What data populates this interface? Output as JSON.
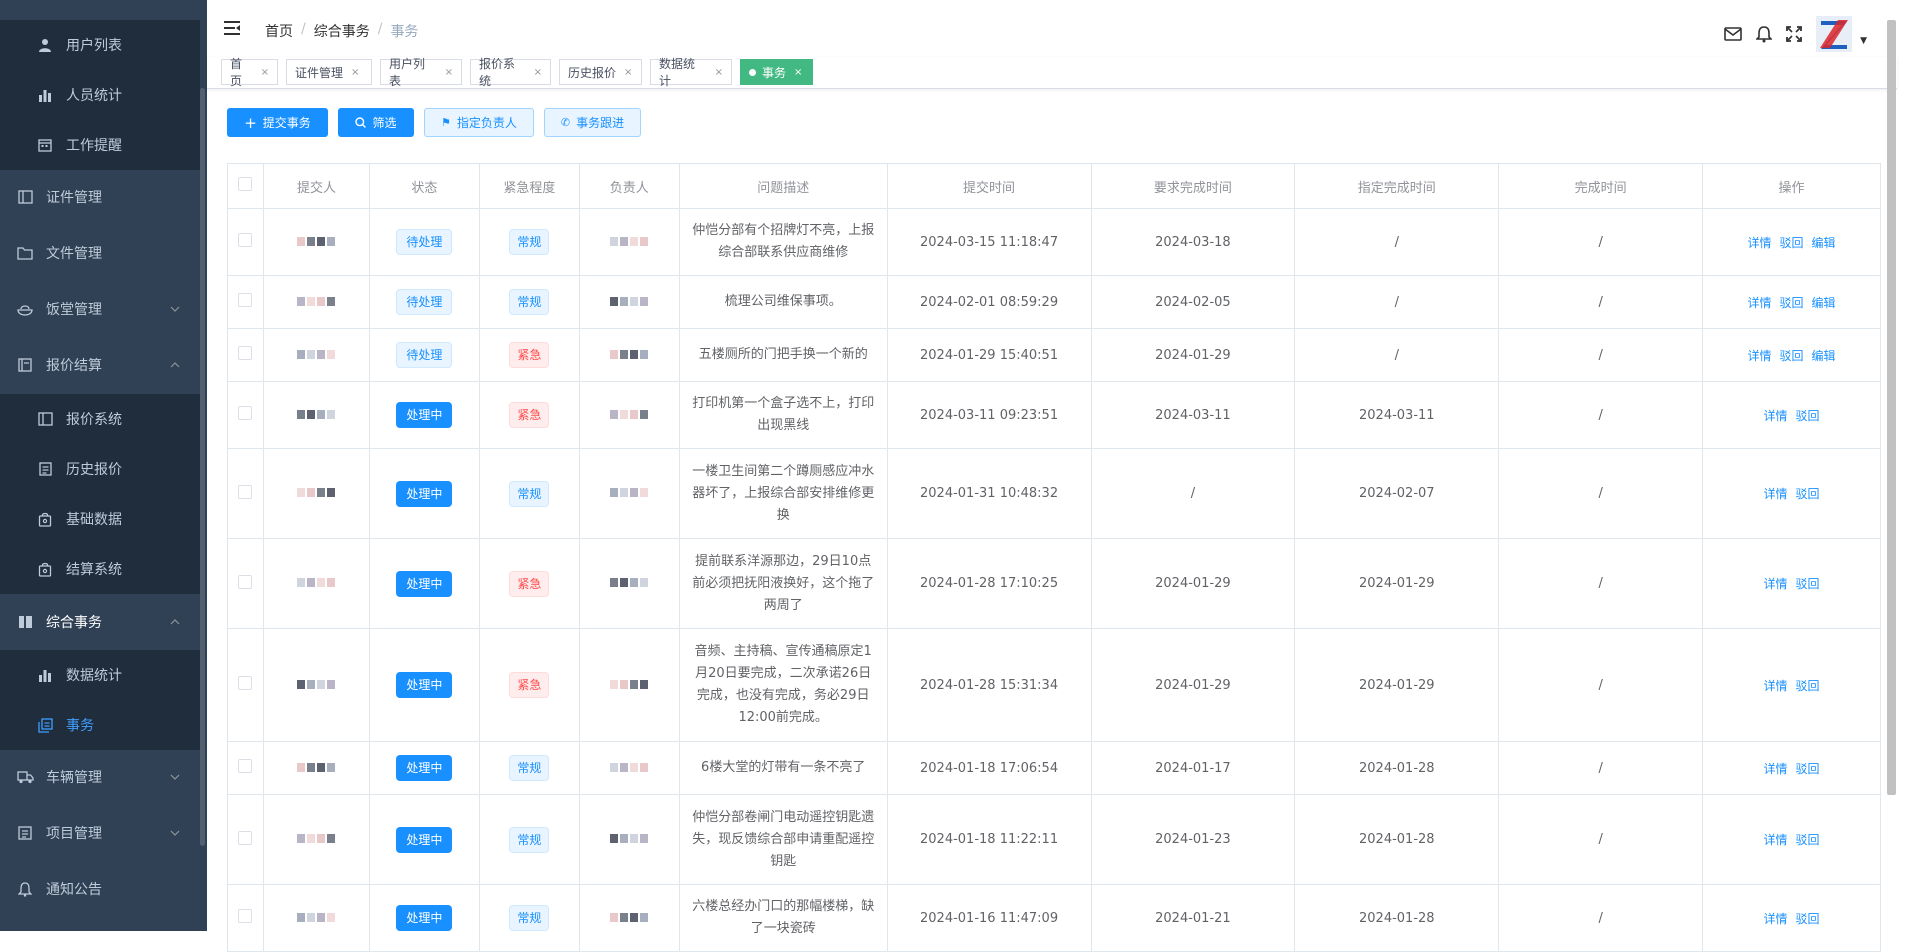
{
  "sidebar": {
    "items": [
      {
        "label": "用户列表",
        "icon": "user-icon",
        "sub": true
      },
      {
        "label": "人员统计",
        "icon": "bar-chart-icon",
        "sub": true
      },
      {
        "label": "工作提醒",
        "icon": "calendar-icon",
        "sub": true
      },
      {
        "label": "证件管理",
        "icon": "book-icon",
        "sub": false
      },
      {
        "label": "文件管理",
        "icon": "folder-icon",
        "sub": false
      },
      {
        "label": "饭堂管理",
        "icon": "bowl-icon",
        "sub": false,
        "arrow": "down"
      },
      {
        "label": "报价结算",
        "icon": "ledger-icon",
        "sub": false,
        "arrow": "up"
      },
      {
        "label": "报价系统",
        "icon": "book-icon",
        "sub": true
      },
      {
        "label": "历史报价",
        "icon": "document-icon",
        "sub": true
      },
      {
        "label": "基础数据",
        "icon": "bag-icon",
        "sub": true
      },
      {
        "label": "结算系统",
        "icon": "bag-icon",
        "sub": true
      },
      {
        "label": "综合事务",
        "icon": "book-open-icon",
        "sub": false,
        "arrow": "up",
        "bold": true
      },
      {
        "label": "数据统计",
        "icon": "bar-chart-icon",
        "sub": true
      },
      {
        "label": "事务",
        "icon": "copy-icon",
        "sub": true,
        "active": true
      },
      {
        "label": "车辆管理",
        "icon": "truck-icon",
        "sub": false,
        "arrow": "down"
      },
      {
        "label": "项目管理",
        "icon": "list-icon",
        "sub": false,
        "arrow": "down"
      },
      {
        "label": "通知公告",
        "icon": "bell-icon",
        "sub": false
      }
    ]
  },
  "breadcrumb": {
    "home": "首页",
    "parent": "综合事务",
    "current": "事务"
  },
  "tags": [
    "首页",
    "证件管理",
    "用户列表",
    "报价系统",
    "历史报价",
    "数据统计",
    "事务"
  ],
  "toolbar": {
    "submit": "提交事务",
    "filter": "筛选",
    "assign": "指定负责人",
    "track": "事务跟进"
  },
  "table": {
    "headers": [
      "提交人",
      "状态",
      "紧急程度",
      "负责人",
      "问题描述",
      "提交时间",
      "要求完成时间",
      "指定完成时间",
      "完成时间",
      "操作"
    ],
    "rows": [
      {
        "status": "待处理",
        "urgency": "常规",
        "desc": "仲恺分部有个招牌灯不亮，上报综合部联系供应商维修",
        "submitted": "2024-03-15 11:18:47",
        "required": "2024-03-18",
        "assigned": "/",
        "completed": "/",
        "ops": [
          "详情",
          "驳回",
          "编辑"
        ]
      },
      {
        "status": "待处理",
        "urgency": "常规",
        "desc": "梳理公司维保事项。",
        "submitted": "2024-02-01 08:59:29",
        "required": "2024-02-05",
        "assigned": "/",
        "completed": "/",
        "ops": [
          "详情",
          "驳回",
          "编辑"
        ]
      },
      {
        "status": "待处理",
        "urgency": "紧急",
        "desc": "五楼厕所的门把手换一个新的",
        "submitted": "2024-01-29 15:40:51",
        "required": "2024-01-29",
        "assigned": "/",
        "completed": "/",
        "ops": [
          "详情",
          "驳回",
          "编辑"
        ]
      },
      {
        "status": "处理中",
        "urgency": "紧急",
        "desc": "打印机第一个盒子选不上，打印出现黑线",
        "submitted": "2024-03-11 09:23:51",
        "required": "2024-03-11",
        "assigned": "2024-03-11",
        "completed": "/",
        "ops": [
          "详情",
          "驳回"
        ]
      },
      {
        "status": "处理中",
        "urgency": "常规",
        "desc": "一楼卫生间第二个蹲厕感应冲水器坏了，上报综合部安排维修更换",
        "submitted": "2024-01-31 10:48:32",
        "required": "/",
        "assigned": "2024-02-07",
        "completed": "/",
        "ops": [
          "详情",
          "驳回"
        ]
      },
      {
        "status": "处理中",
        "urgency": "紧急",
        "desc": "提前联系洋源那边，29日10点前必须把抚阳液换好，这个拖了两周了",
        "submitted": "2024-01-28 17:10:25",
        "required": "2024-01-29",
        "assigned": "2024-01-29",
        "completed": "/",
        "ops": [
          "详情",
          "驳回"
        ]
      },
      {
        "status": "处理中",
        "urgency": "紧急",
        "desc": "音频、主持稿、宣传通稿原定1月20日要完成，二次承诺26日完成，也没有完成，务必29日12:00前完成。",
        "submitted": "2024-01-28 15:31:34",
        "required": "2024-01-29",
        "assigned": "2024-01-29",
        "completed": "/",
        "ops": [
          "详情",
          "驳回"
        ]
      },
      {
        "status": "处理中",
        "urgency": "常规",
        "desc": "6楼大堂的灯带有一条不亮了",
        "submitted": "2024-01-18 17:06:54",
        "required": "2024-01-17",
        "assigned": "2024-01-28",
        "completed": "/",
        "ops": [
          "详情",
          "驳回"
        ]
      },
      {
        "status": "处理中",
        "urgency": "常规",
        "desc": "仲恺分部卷闸门电动遥控钥匙遗失，现反馈综合部申请重配遥控钥匙",
        "submitted": "2024-01-18 11:22:11",
        "required": "2024-01-23",
        "assigned": "2024-01-28",
        "completed": "/",
        "ops": [
          "详情",
          "驳回"
        ]
      },
      {
        "status": "处理中",
        "urgency": "常规",
        "desc": "六楼总经办门口的那幅楼梯，缺了一块瓷砖",
        "submitted": "2024-01-16 11:47:09",
        "required": "2024-01-21",
        "assigned": "2024-01-28",
        "completed": "/",
        "ops": [
          "详情",
          "驳回"
        ]
      }
    ]
  },
  "colors": {
    "sidebar_bg": "#304156",
    "sidebar_sub_bg": "#1f2d3d",
    "primary": "#1890ff",
    "active_tag": "#42b983",
    "urgent": "#ff4949"
  }
}
